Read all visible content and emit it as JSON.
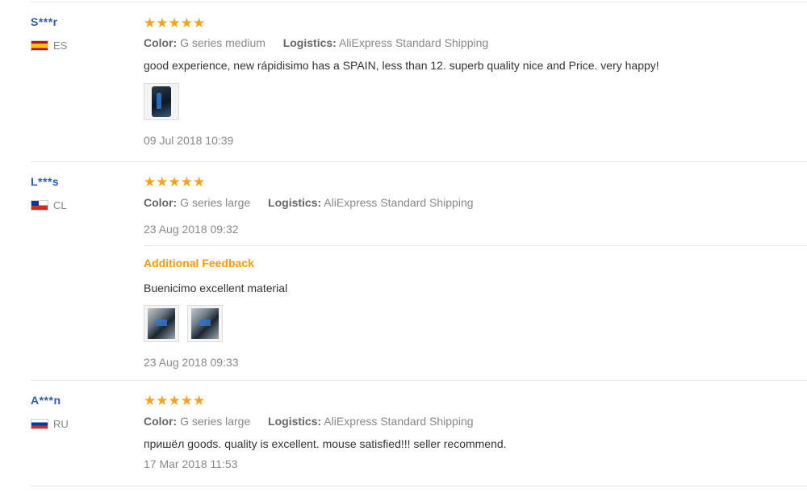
{
  "reviews": [
    {
      "user": "S***r",
      "country_code": "ES",
      "stars": "★★★★★",
      "color_label": "Color:",
      "color_value": "G series medium",
      "logistics_label": "Logistics:",
      "logistics_value": "AliExpress Standard Shipping",
      "text": "good experience, new rápidisimo has a SPAIN, less than 12. superb quality nice and Price. very happy!",
      "date": "09 Jul 2018 10:39"
    },
    {
      "user": "L***s",
      "country_code": "CL",
      "stars": "★★★★★",
      "color_label": "Color:",
      "color_value": "G series large",
      "logistics_label": "Logistics:",
      "logistics_value": "AliExpress Standard Shipping",
      "date": "23 Aug 2018 09:32",
      "additional_feedback_label": "Additional Feedback",
      "additional_text": "Buenicimo excellent material",
      "additional_date": "23 Aug 2018 09:33"
    },
    {
      "user": "A***n",
      "country_code": "RU",
      "stars": "★★★★★",
      "color_label": "Color:",
      "color_value": "G series large",
      "logistics_label": "Logistics:",
      "logistics_value": "AliExpress Standard Shipping",
      "text": "пришёл goods. quality is excellent. mouse satisfied!!! seller recommend.",
      "date": "17 Mar 2018 11:53"
    }
  ],
  "colors": {
    "username": "#2f5ea8",
    "stars": "#f7a21b",
    "additional_feedback": "#f59b00"
  }
}
